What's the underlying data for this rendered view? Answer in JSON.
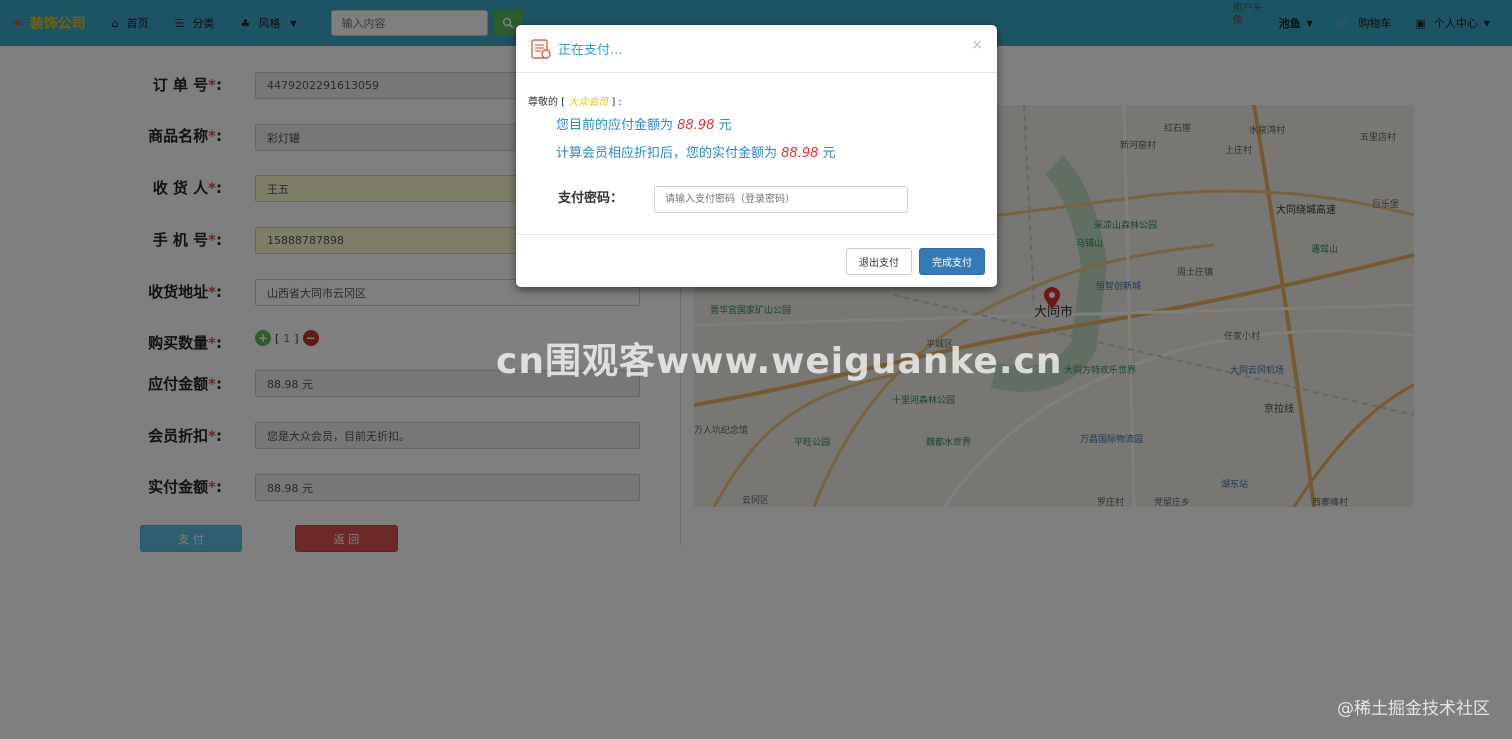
{
  "navbar": {
    "brand": "装饰公司",
    "home": "首页",
    "category": "分类",
    "style": "风格",
    "search_placeholder": "输入内容",
    "avatar_alt": "用户头像",
    "username": "池鱼",
    "cart": "购物车",
    "profile": "个人中心"
  },
  "form": {
    "order_no": {
      "label": "订 单 号",
      "value": "4479202291613059"
    },
    "product": {
      "label": "商品名称",
      "value": "彩灯罐"
    },
    "receiver": {
      "label": "收 货 人",
      "value": "王五"
    },
    "phone": {
      "label": "手 机 号",
      "value": "15888787898"
    },
    "address": {
      "label": "收货地址",
      "value": "山西省大同市云冈区"
    },
    "quantity": {
      "label": "购买数量",
      "value": "1"
    },
    "payable": {
      "label": "应付金额",
      "value": "88.98 元"
    },
    "discount": {
      "label": "会员折扣",
      "value": "您是大众会员，目前无折扣。"
    },
    "actual": {
      "label": "实付金额",
      "value": "88.98 元"
    },
    "required_mark": "*",
    "colon": ":",
    "pay_button": "支 付",
    "back_button": "返 回"
  },
  "map": {
    "city": "大同市",
    "labels": [
      "红石崖",
      "水泉湾村",
      "新河窑村",
      "上庄村",
      "五里店村",
      "大同绕城高速",
      "巨乐堡",
      "采凉山森林公园",
      "马铺山",
      "遇驾山",
      "周士庄镇",
      "恒智创新城",
      "晋华宫国家矿山公园",
      "平城区",
      "任家小村",
      "大同方特欢乐世界",
      "大同云冈机场",
      "十里河森林公园",
      "京拉线",
      "平旺公园",
      "魏都水世界",
      "万昌国际物流园",
      "湖东站",
      "云冈区",
      "罗庄村",
      "党留庄乡",
      "西寨峰村",
      "万人坑纪念馆"
    ]
  },
  "modal": {
    "title": "正在支付...",
    "greeting_prefix": "尊敬的 [",
    "member_level": "大众会员",
    "greeting_suffix": "] :",
    "payable_text": "您目前的应付金额为",
    "payable_amount": "88.98",
    "actual_text": "计算会员相应折扣后，您的实付金额为",
    "actual_amount": "88.98",
    "currency": "元",
    "password_label": "支付密码：",
    "password_placeholder": "请输入支付密码（登录密码）",
    "exit_button": "退出支付",
    "done_button": "完成支付",
    "close": "×"
  },
  "watermarks": {
    "center": "cn围观客www.weiguanke.cn",
    "corner": "@稀土掘金技术社区"
  },
  "colors": {
    "navbar": "#3aa8c9",
    "brand": "#f0c020",
    "title_blue": "#2a9fd6",
    "amount_red": "#e03030",
    "primary": "#337ab7",
    "info": "#5bc0de",
    "danger": "#d9534f"
  }
}
